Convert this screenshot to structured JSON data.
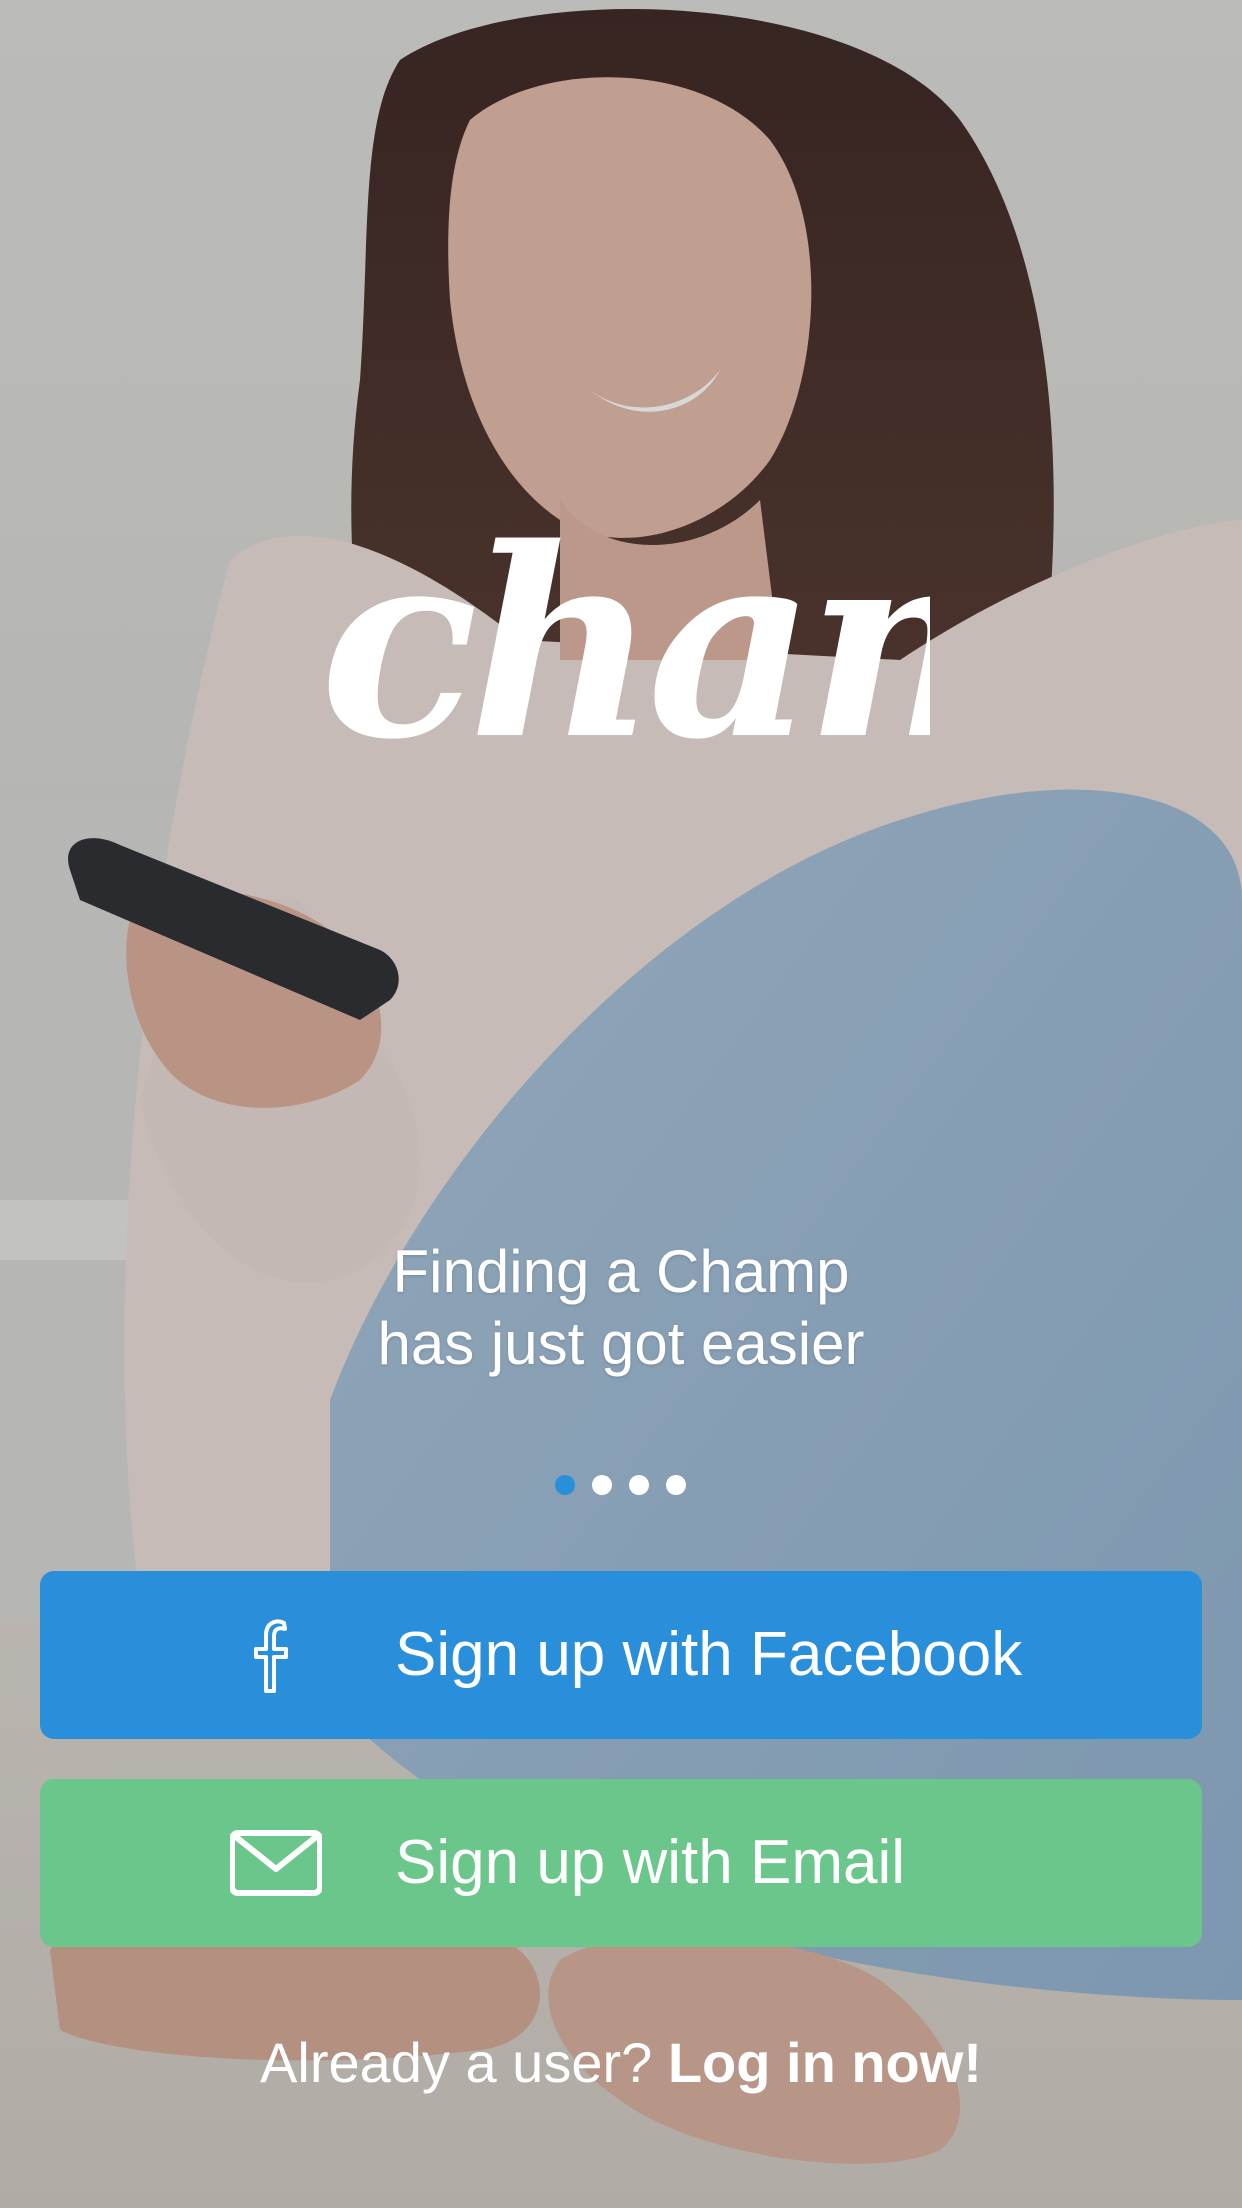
{
  "app": {
    "logo_text": "champ"
  },
  "tagline": {
    "line1": "Finding a Champ",
    "line2": "has just got easier"
  },
  "pager": {
    "count": 4,
    "active_index": 0,
    "active_color": "#2a8fdb",
    "inactive_color": "#ffffff"
  },
  "buttons": {
    "facebook": {
      "label": "Sign up with Facebook",
      "icon": "facebook-icon",
      "color": "#2a8fdb"
    },
    "email": {
      "label": "Sign up with Email",
      "icon": "envelope-icon",
      "color": "#6ac68a"
    }
  },
  "login": {
    "prompt": "Already a user?",
    "link": "Log in now!"
  }
}
